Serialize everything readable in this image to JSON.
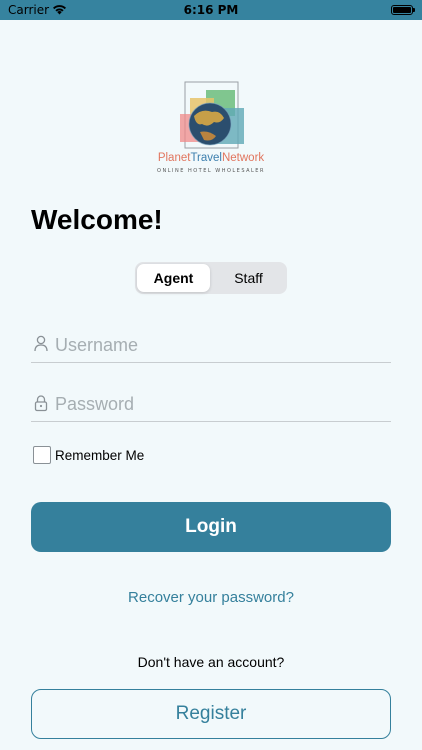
{
  "status_bar": {
    "carrier": "Carrier",
    "time": "6:16 PM"
  },
  "logo": {
    "brand_part1": "Planet",
    "brand_part2": "Travel",
    "brand_part3": "Network",
    "tagline": "ONLINE HOTEL WHOLESALER"
  },
  "welcome_title": "Welcome!",
  "user_type": {
    "options": [
      "Agent",
      "Staff"
    ],
    "selected": "Agent"
  },
  "form": {
    "username_placeholder": "Username",
    "username_value": "",
    "password_placeholder": "Password",
    "password_value": "",
    "remember_label": "Remember Me",
    "remember_checked": false
  },
  "login_label": "Login",
  "recover_label": "Recover your password?",
  "no_account_text": "Don't have an account?",
  "register_label": "Register",
  "colors": {
    "accent": "#35809c",
    "background": "#f2f9fb"
  },
  "icons": [
    "wifi-icon",
    "battery-icon",
    "user-icon",
    "lock-icon"
  ]
}
